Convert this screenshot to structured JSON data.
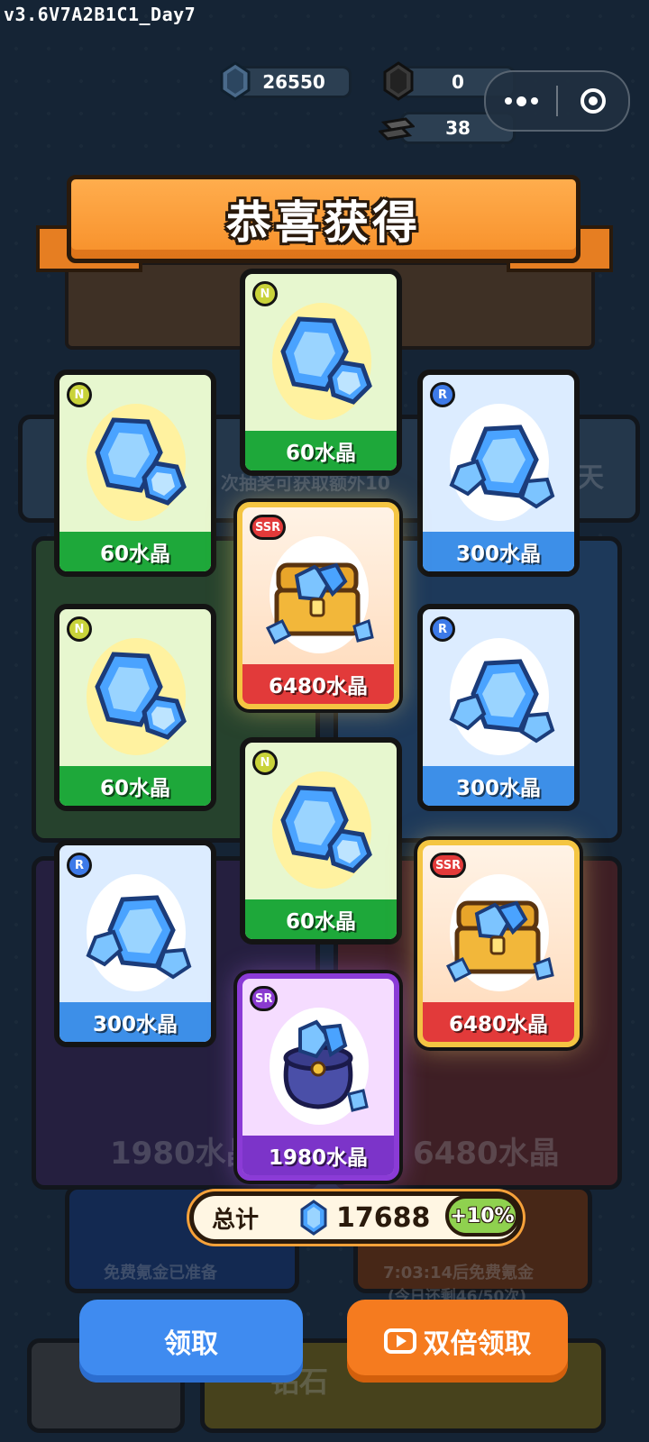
{
  "version": "v3.6V7A2B1C1_Day7",
  "resources": {
    "crystal": "26550",
    "dark_crystal": "0",
    "gold_bar": "38"
  },
  "title": "恭喜获得",
  "rewards": [
    {
      "rarity": "N",
      "label": "60水晶",
      "kind": "crystal-small-icon"
    },
    {
      "rarity": "N",
      "label": "60水晶",
      "kind": "crystal-small-icon"
    },
    {
      "rarity": "R",
      "label": "300水晶",
      "kind": "crystal-cluster-icon"
    },
    {
      "rarity": "SSR",
      "label": "6480水晶",
      "kind": "treasure-chest-icon"
    },
    {
      "rarity": "N",
      "label": "60水晶",
      "kind": "crystal-small-icon"
    },
    {
      "rarity": "R",
      "label": "300水晶",
      "kind": "crystal-cluster-icon"
    },
    {
      "rarity": "N",
      "label": "60水晶",
      "kind": "crystal-small-icon"
    },
    {
      "rarity": "R",
      "label": "300水晶",
      "kind": "crystal-cluster-icon"
    },
    {
      "rarity": "SSR",
      "label": "6480水晶",
      "kind": "treasure-chest-icon"
    },
    {
      "rarity": "SR",
      "label": "1980水晶",
      "kind": "crystal-bag-icon"
    }
  ],
  "total": {
    "label": "总计",
    "value": "17688",
    "bonus": "+10%"
  },
  "buttons": {
    "claim": "领取",
    "double_claim": "双倍领取"
  },
  "background": {
    "hint": "次抽奖可获取额外10",
    "day_suffix": "天",
    "sr_price": "1980水晶",
    "ssr_price": "6480水晶",
    "single_draw_status": "免费氪金已准备",
    "timer_text": "7:03:14后免费氪金",
    "remaining_text": "(今日还剩46/50次)",
    "diamond_text": "钻石"
  },
  "colors": {
    "n_header": "#1ea83a",
    "r_header": "#3d8fe8",
    "ssr_header": "#e23a3a",
    "sr_header": "#7c34c9",
    "claim_button": "#3f8bf0",
    "double_button": "#f57b1f"
  }
}
